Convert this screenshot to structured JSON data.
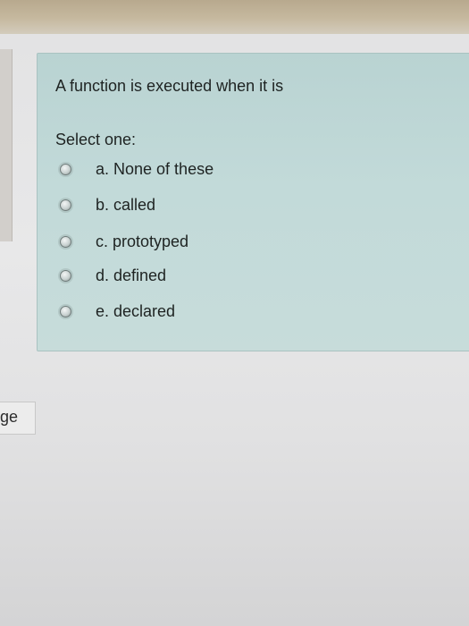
{
  "question": {
    "text": "A function is executed when it is",
    "prompt": "Select one:",
    "options": [
      {
        "label": "a. None of these"
      },
      {
        "label": "b. called"
      },
      {
        "label": "c. prototyped"
      },
      {
        "label": "d. defined"
      },
      {
        "label": "e. declared"
      }
    ]
  },
  "side_tab": {
    "label": "ge"
  }
}
